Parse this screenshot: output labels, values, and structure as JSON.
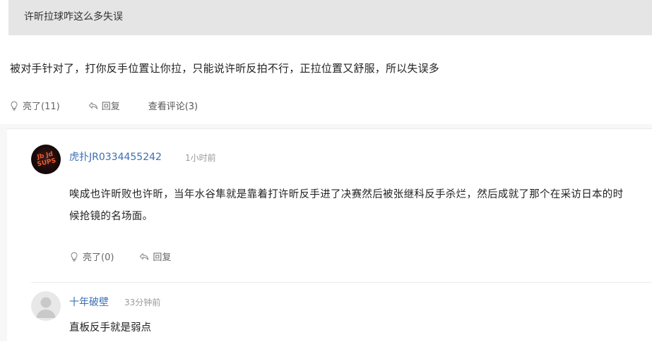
{
  "quote": {
    "text": "许昕拉球咋这么多失误"
  },
  "main_comment": {
    "text": "被对手针对了，打你反手位置让你拉，只能说许昕反拍不行，正拉位置又舒服，所以失误多",
    "like_label": "亮了(11)",
    "reply_label": "回复",
    "view_comments_label": "查看评论(3)"
  },
  "replies": [
    {
      "username": "虎扑JR0334455242",
      "time": "1小时前",
      "avatar_icon": "avatar-logo-icon",
      "text": "唉成也许昕败也许昕，当年水谷隼就是靠着打许昕反手进了决赛然后被张继科反手杀烂，然后成就了那个在采访日本的时候抢镜的名场面。",
      "like_label": "亮了(0)",
      "reply_label": "回复"
    },
    {
      "username": "十年破壁",
      "time": "33分钟前",
      "avatar_icon": "default-user-icon",
      "text": "直板反手就是弱点"
    }
  ],
  "colors": {
    "username": "#3a6fb5",
    "meta": "#999999",
    "quote_bg": "#e5e5e5",
    "panel_bg": "#f7f7f7"
  }
}
